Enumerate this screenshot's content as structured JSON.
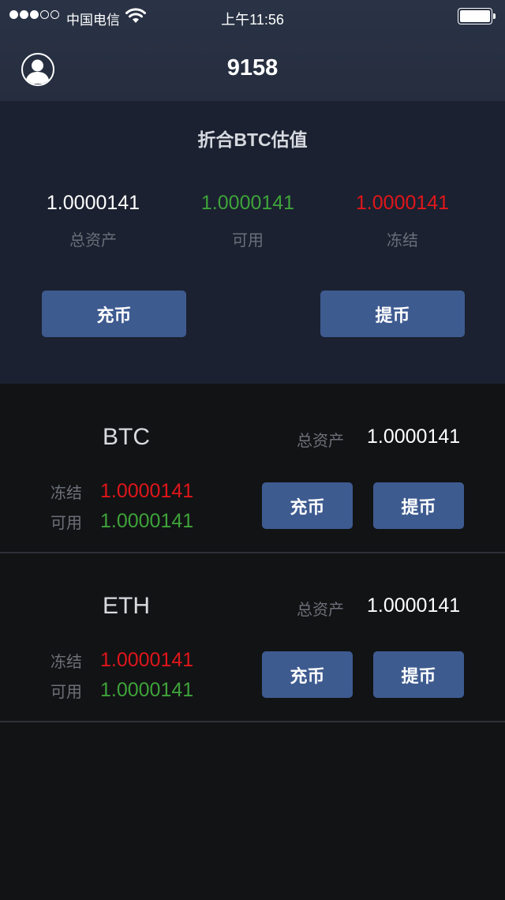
{
  "status_bar": {
    "carrier": "中国电信",
    "time": "上午11:56",
    "signal_bars_filled": 3,
    "signal_bars_total": 5
  },
  "nav": {
    "title": "9158",
    "avatar_icon": "user-avatar-icon"
  },
  "summary": {
    "title": "折合BTC估值",
    "total_value": "1.0000141",
    "total_label": "总资产",
    "available_value": "1.0000141",
    "available_label": "可用",
    "frozen_value": "1.0000141",
    "frozen_label": "冻结",
    "deposit_label": "充币",
    "withdraw_label": "提币"
  },
  "assets": [
    {
      "coin": "BTC",
      "total_label": "总资产",
      "total_value": "1.0000141",
      "frozen_label": "冻结",
      "frozen_value": "1.0000141",
      "available_label": "可用",
      "available_value": "1.0000141",
      "deposit_label": "充币",
      "withdraw_label": "提币"
    },
    {
      "coin": "ETH",
      "total_label": "总资产",
      "total_value": "1.0000141",
      "frozen_label": "冻结",
      "frozen_value": "1.0000141",
      "available_label": "可用",
      "available_value": "1.0000141",
      "deposit_label": "充币",
      "withdraw_label": "提币"
    }
  ],
  "colors": {
    "header_bg": "#2a3346",
    "summary_bg": "#1b2130",
    "page_bg": "#121315",
    "button_bg": "#3e5b90",
    "available_green": "#3ea33a",
    "frozen_red": "#e0161a"
  }
}
